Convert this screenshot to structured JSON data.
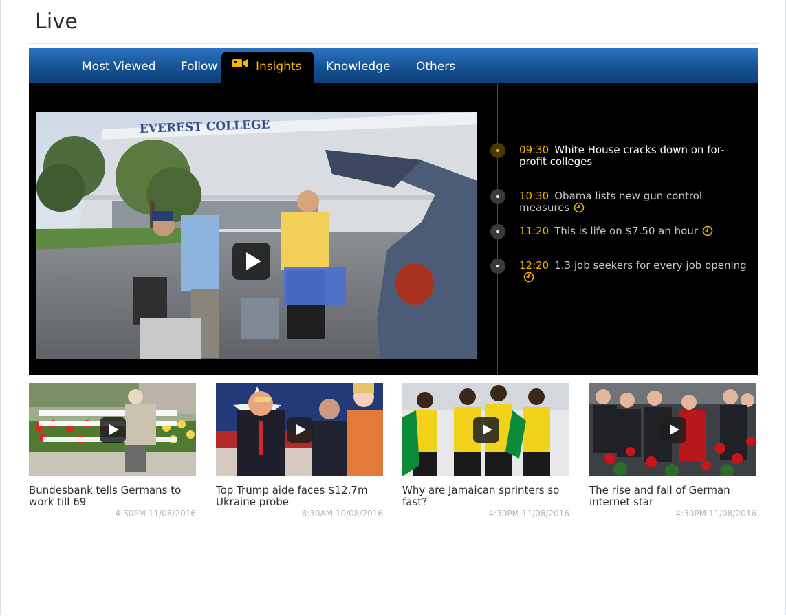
{
  "page": {
    "title": "Live"
  },
  "tabs": [
    {
      "label": "Most Viewed",
      "active": false
    },
    {
      "label": "Follow",
      "active": false
    },
    {
      "label": "Insights",
      "active": true,
      "icon": "video-camera-icon"
    },
    {
      "label": "Knowledge",
      "active": false
    },
    {
      "label": "Others",
      "active": false
    }
  ],
  "colors": {
    "accent": "#f5b400",
    "tabbar": "#155293",
    "player_bg": "#000000"
  },
  "timeline": [
    {
      "time": "09:30",
      "title": "White House cracks down on for-profit colleges",
      "active": true,
      "has_clock": false
    },
    {
      "time": "10:30",
      "title": "Obama lists new gun control measures",
      "active": false,
      "has_clock": true
    },
    {
      "time": "11:20",
      "title": "This is life on $7.50 an hour",
      "active": false,
      "has_clock": true
    },
    {
      "time": "12:20",
      "title": "1.3 job seekers for every job opening",
      "active": false,
      "has_clock": true
    }
  ],
  "cards": [
    {
      "title": "Bundesbank tells Germans to work till 69",
      "time": "4:30PM 11/08/2016"
    },
    {
      "title": "Top Trump aide faces $12.7m Ukraine probe",
      "time": "8:30AM 10/08/2016"
    },
    {
      "title": "Why are Jamaican sprinters so fast?",
      "time": "4:30PM 11/08/2016"
    },
    {
      "title": "The rise and fall of German internet star",
      "time": "4:30PM 11/08/2016"
    }
  ],
  "video": {
    "sign_text": "EVEREST COLLEGE"
  }
}
